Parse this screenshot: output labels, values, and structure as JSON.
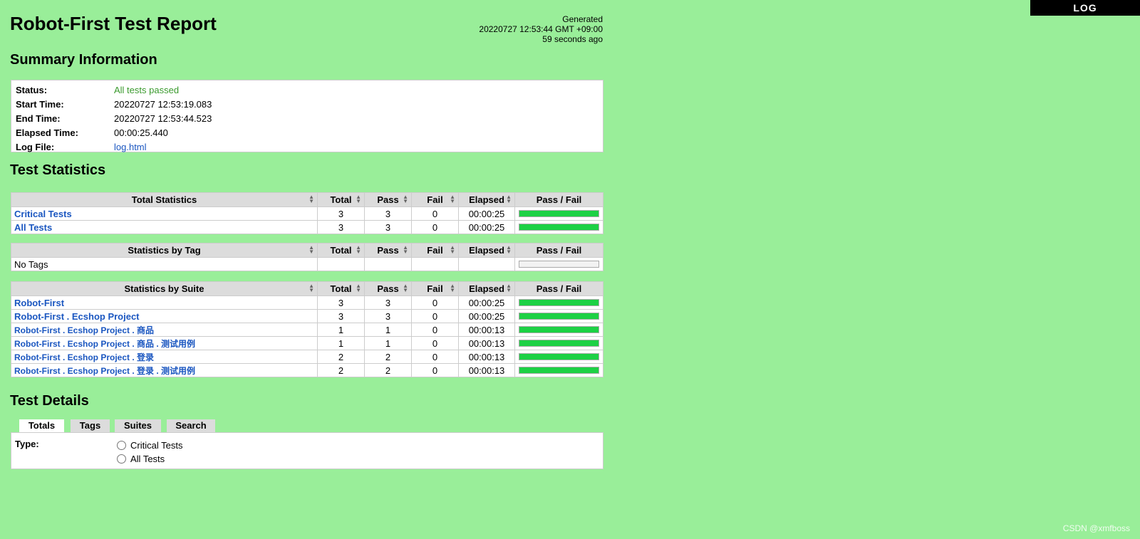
{
  "header": {
    "title": "Robot-First Test Report",
    "generated_label": "Generated",
    "generated_time": "20220727 12:53:44 GMT +09:00",
    "generated_ago": "59 seconds ago",
    "log_button": "LOG"
  },
  "sections": {
    "summary": "Summary Information",
    "statistics": "Test Statistics",
    "details": "Test Details"
  },
  "summary": {
    "rows": [
      {
        "label": "Status:",
        "value": "All tests passed"
      },
      {
        "label": "Start Time:",
        "value": "20220727 12:53:19.083"
      },
      {
        "label": "End Time:",
        "value": "20220727 12:53:44.523"
      },
      {
        "label": "Elapsed Time:",
        "value": "00:00:25.440"
      },
      {
        "label": "Log File:",
        "value": "log.html"
      }
    ]
  },
  "columns": {
    "total": "Total",
    "pass": "Pass",
    "fail": "Fail",
    "elapsed": "Elapsed",
    "passfail": "Pass / Fail"
  },
  "total_statistics": {
    "header": "Total Statistics",
    "rows": [
      {
        "name": "Critical Tests",
        "total": "3",
        "pass": "3",
        "fail": "0",
        "elapsed": "00:00:25",
        "pass_ratio": 1
      },
      {
        "name": "All Tests",
        "total": "3",
        "pass": "3",
        "fail": "0",
        "elapsed": "00:00:25",
        "pass_ratio": 1
      }
    ]
  },
  "tag_statistics": {
    "header": "Statistics by Tag",
    "rows": [
      {
        "name": "No Tags",
        "total": "",
        "pass": "",
        "fail": "",
        "elapsed": "",
        "pass_ratio": 0
      }
    ]
  },
  "suite_statistics": {
    "header": "Statistics by Suite",
    "rows": [
      {
        "name": "Robot-First",
        "total": "3",
        "pass": "3",
        "fail": "0",
        "elapsed": "00:00:25",
        "pass_ratio": 1
      },
      {
        "name": "Robot-First . Ecshop Project",
        "total": "3",
        "pass": "3",
        "fail": "0",
        "elapsed": "00:00:25",
        "pass_ratio": 1
      },
      {
        "name": "Robot-First . Ecshop Project . 商品",
        "total": "1",
        "pass": "1",
        "fail": "0",
        "elapsed": "00:00:13",
        "pass_ratio": 1
      },
      {
        "name": "Robot-First . Ecshop Project . 商品 . 测试用例",
        "total": "1",
        "pass": "1",
        "fail": "0",
        "elapsed": "00:00:13",
        "pass_ratio": 1
      },
      {
        "name": "Robot-First . Ecshop Project . 登录",
        "total": "2",
        "pass": "2",
        "fail": "0",
        "elapsed": "00:00:13",
        "pass_ratio": 1
      },
      {
        "name": "Robot-First . Ecshop Project . 登录 . 测试用例",
        "total": "2",
        "pass": "2",
        "fail": "0",
        "elapsed": "00:00:13",
        "pass_ratio": 1
      }
    ]
  },
  "details": {
    "tabs": [
      "Totals",
      "Tags",
      "Suites",
      "Search"
    ],
    "active_tab": "Totals",
    "type_label": "Type:",
    "options": [
      "Critical Tests",
      "All Tests"
    ]
  },
  "colors": {
    "background": "#99ee99",
    "pass_bar": "#1dd145",
    "link": "#1a56c0",
    "status_passed": "#3a9a2d"
  },
  "watermark": "CSDN @xmfboss"
}
